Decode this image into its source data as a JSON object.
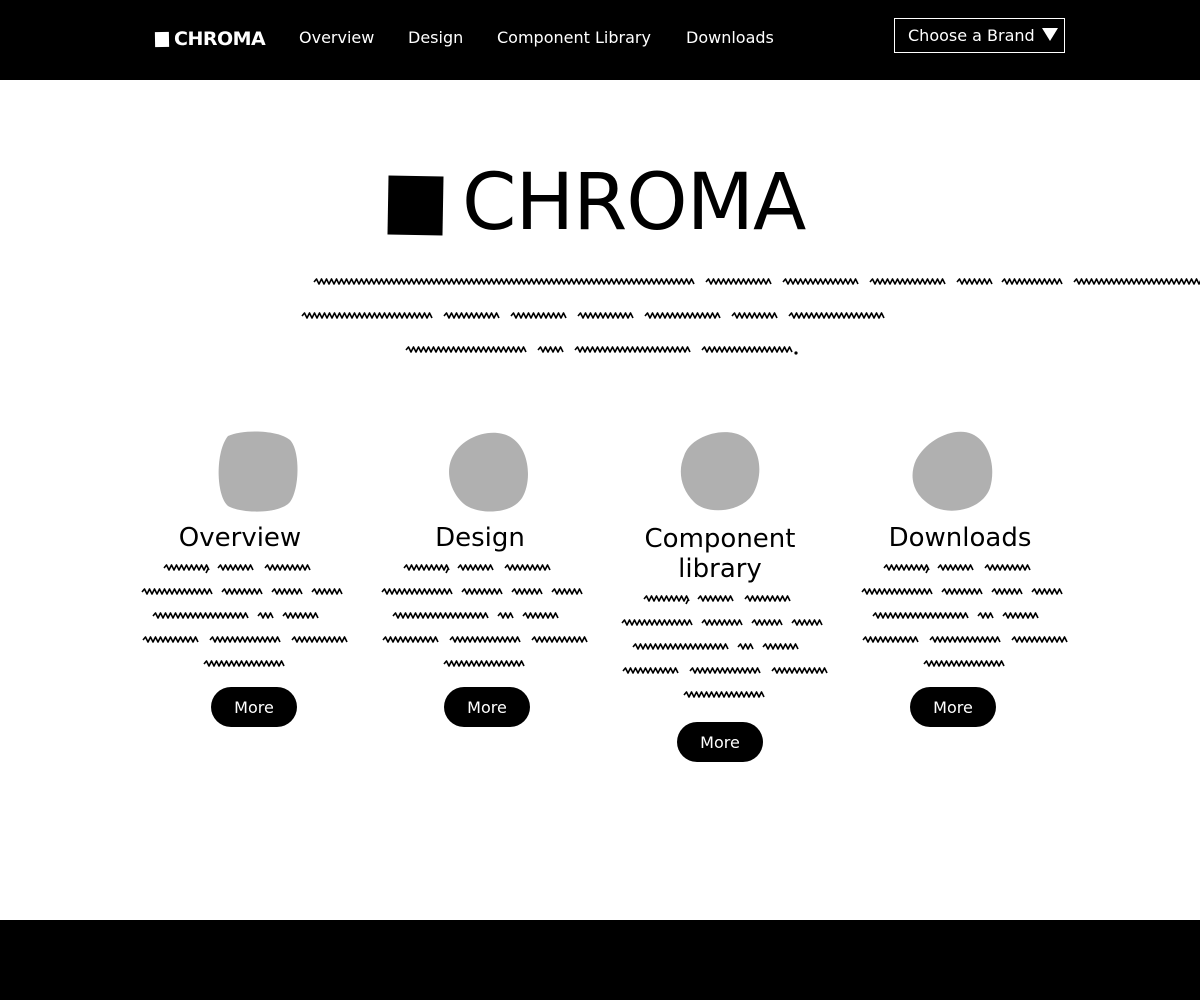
{
  "header": {
    "brand": "CHROMA",
    "nav": [
      "Overview",
      "Design",
      "Component Library",
      "Downloads"
    ],
    "brand_select": {
      "label": "Choose a Brand"
    }
  },
  "hero": {
    "title": "CHROMA"
  },
  "columns": [
    {
      "title": "Overview",
      "button": "More"
    },
    {
      "title": "Design",
      "button": "More"
    },
    {
      "title": "Component library",
      "button": "More"
    },
    {
      "title": "Downloads",
      "button": "More"
    }
  ],
  "colors": {
    "bar": "#000000",
    "background": "#ffffff",
    "placeholder_blob": "#b0b0b0"
  }
}
